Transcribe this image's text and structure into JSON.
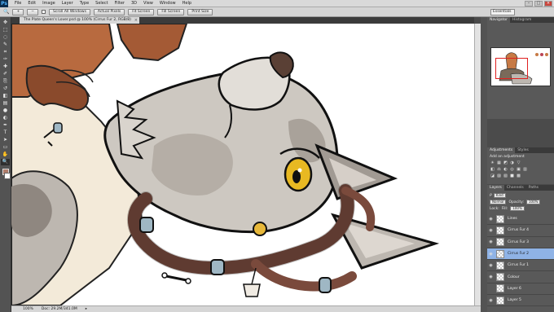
{
  "app": {
    "logo": "Ps"
  },
  "menu": [
    "File",
    "Edit",
    "Image",
    "Layer",
    "Type",
    "Select",
    "Filter",
    "3D",
    "View",
    "Window",
    "Help"
  ],
  "window_controls": {
    "minimize": "–",
    "maximize": "□",
    "close": "×"
  },
  "options_bar": {
    "tool_glyph": "🔍",
    "zoom_in_glyph": "+",
    "zoom_out_glyph": "−",
    "scroll_all": "Scroll All Windows",
    "actual_pixels": "Actual Pixels",
    "fit_screen": "Fit Screen",
    "fill_screen": "Fill Screen",
    "print_size": "Print Size",
    "workspace": "Essentials"
  },
  "tools": [
    "move-tool",
    "marquee-tool",
    "lasso-tool",
    "quick-select-tool",
    "crop-tool",
    "eyedropper-tool",
    "healing-tool",
    "brush-tool",
    "clone-stamp-tool",
    "history-brush-tool",
    "eraser-tool",
    "gradient-tool",
    "blur-tool",
    "dodge-tool",
    "pen-tool",
    "type-tool",
    "path-select-tool",
    "shape-tool",
    "hand-tool",
    "zoom-tool"
  ],
  "tool_glyphs": [
    "✥",
    "⬚",
    "◌",
    "✎",
    "⌗",
    "✑",
    "✚",
    "✐",
    "⎘",
    "↺",
    "◧",
    "▤",
    "●",
    "◐",
    "✒",
    "T",
    "➤",
    "▭",
    "✋",
    "🔍"
  ],
  "document": {
    "tab_title": "The Plate Queen's Lover.psd @ 100% (Cirrus Fur 2, RGB/8)",
    "close_glyph": "×"
  },
  "status": {
    "zoom": "100%",
    "doc_size": "Doc: 29.2M/341.0M",
    "arrow": "▸"
  },
  "colors": {
    "foreground": "#b07d6b",
    "background": "#ffffff",
    "selected_layer": "#8fb3e6",
    "fur": "#c9c4bd",
    "hair": "#7a4a3c",
    "eye": "#e8b922"
  },
  "navigator": {
    "tabs": [
      "Navigator",
      "Histogram"
    ]
  },
  "adjustments": {
    "tabs": [
      "Adjustments",
      "Styles"
    ],
    "title": "Add an adjustment",
    "row1": [
      "☀",
      "▦",
      "◩",
      "◑",
      "▽"
    ],
    "row2": [
      "◧",
      "⚖",
      "◐",
      "◎",
      "▣",
      "▥"
    ],
    "row3": [
      "◪",
      "▨",
      "▧",
      "■",
      "▩"
    ]
  },
  "layers": {
    "tabs": [
      "Layers",
      "Channels",
      "Paths"
    ],
    "filter_label": "Kind",
    "filter_glyph": "ρ",
    "blend_mode": "Normal",
    "opacity_label": "Opacity:",
    "opacity": "100%",
    "lock_label": "Lock:",
    "fill_label": "Fill:",
    "fill": "100%",
    "eye_glyph": "◉",
    "items": [
      {
        "name": "Lines",
        "visible": true,
        "selected": false
      },
      {
        "name": "Cirrus Fur 4",
        "visible": true,
        "selected": false
      },
      {
        "name": "Cirrus Fur 3",
        "visible": true,
        "selected": false
      },
      {
        "name": "Cirrus Fur 2",
        "visible": true,
        "selected": true
      },
      {
        "name": "Cirrus Fur 1",
        "visible": true,
        "selected": false
      },
      {
        "name": "Colour",
        "visible": true,
        "selected": false
      },
      {
        "name": "Layer 6",
        "visible": false,
        "selected": false
      },
      {
        "name": "Layer 5",
        "visible": true,
        "selected": false
      }
    ]
  }
}
